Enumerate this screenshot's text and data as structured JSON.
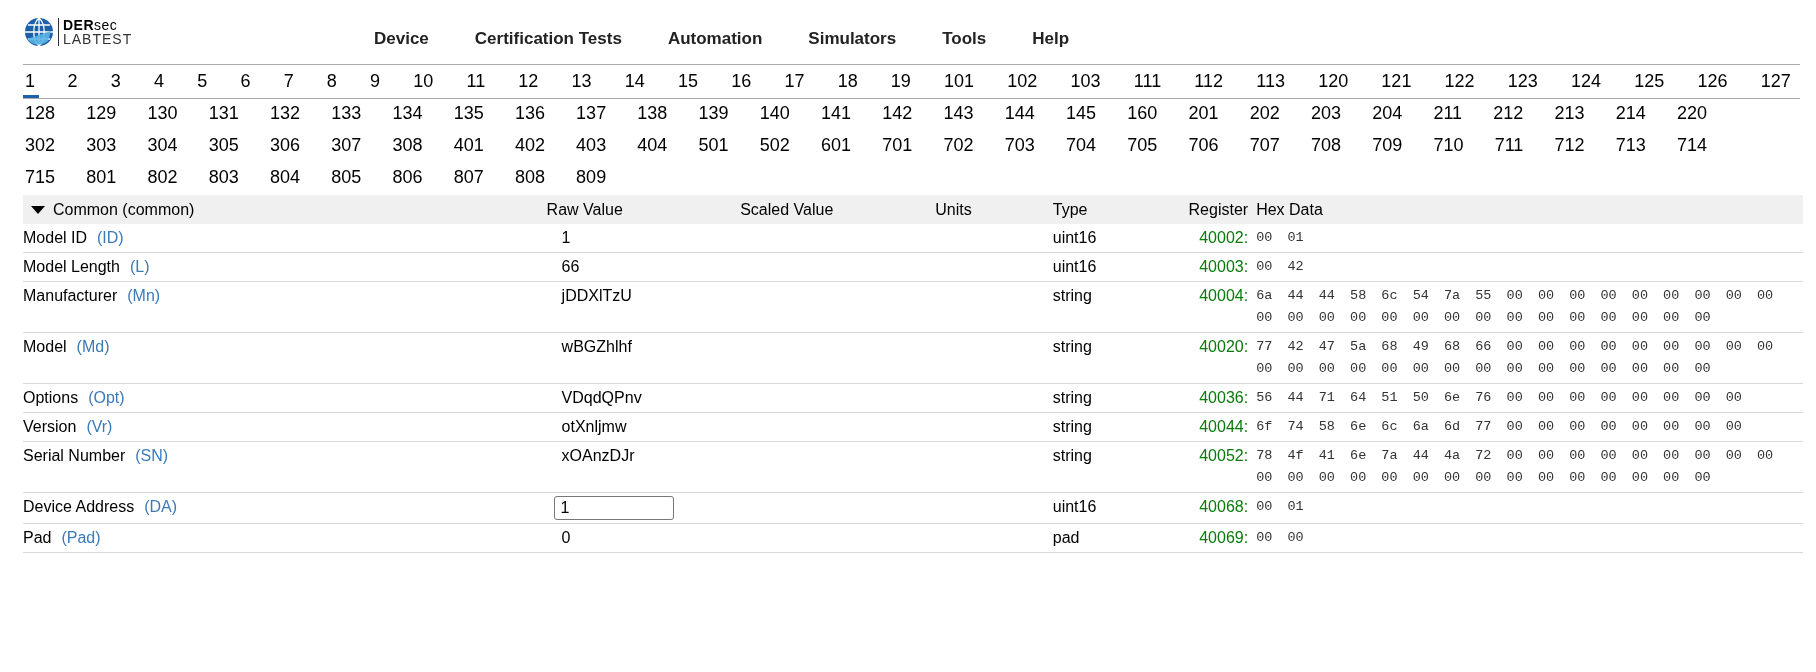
{
  "logo": {
    "brand_bold": "DER",
    "brand_light": "sec",
    "subtitle": "LABTEST"
  },
  "nav": [
    "Device",
    "Certification Tests",
    "Automation",
    "Simulators",
    "Tools",
    "Help"
  ],
  "model_tabs": [
    [
      {
        "label": "1",
        "selected": true
      },
      {
        "label": "2",
        "selected": false
      },
      {
        "label": "3",
        "selected": false
      },
      {
        "label": "4",
        "selected": false
      },
      {
        "label": "5",
        "selected": false
      },
      {
        "label": "6",
        "selected": false
      },
      {
        "label": "7",
        "selected": false
      },
      {
        "label": "8",
        "selected": false
      },
      {
        "label": "9",
        "selected": false
      },
      {
        "label": "10",
        "selected": false
      },
      {
        "label": "11",
        "selected": false
      },
      {
        "label": "12",
        "selected": false
      },
      {
        "label": "13",
        "selected": false
      },
      {
        "label": "14",
        "selected": false
      },
      {
        "label": "15",
        "selected": false
      },
      {
        "label": "16",
        "selected": false
      },
      {
        "label": "17",
        "selected": false
      },
      {
        "label": "18",
        "selected": false
      },
      {
        "label": "19",
        "selected": false
      },
      {
        "label": "101",
        "selected": false
      },
      {
        "label": "102",
        "selected": false
      },
      {
        "label": "103",
        "selected": false
      },
      {
        "label": "111",
        "selected": false
      },
      {
        "label": "112",
        "selected": false
      },
      {
        "label": "113",
        "selected": false
      },
      {
        "label": "120",
        "selected": false
      },
      {
        "label": "121",
        "selected": false
      },
      {
        "label": "122",
        "selected": false
      },
      {
        "label": "123",
        "selected": false
      },
      {
        "label": "124",
        "selected": false
      },
      {
        "label": "125",
        "selected": false
      },
      {
        "label": "126",
        "selected": false
      },
      {
        "label": "127",
        "selected": false
      }
    ],
    [
      {
        "label": "128",
        "selected": false
      },
      {
        "label": "129",
        "selected": false
      },
      {
        "label": "130",
        "selected": false
      },
      {
        "label": "131",
        "selected": false
      },
      {
        "label": "132",
        "selected": false
      },
      {
        "label": "133",
        "selected": false
      },
      {
        "label": "134",
        "selected": false
      },
      {
        "label": "135",
        "selected": false
      },
      {
        "label": "136",
        "selected": false
      },
      {
        "label": "137",
        "selected": false
      },
      {
        "label": "138",
        "selected": false
      },
      {
        "label": "139",
        "selected": false
      },
      {
        "label": "140",
        "selected": false
      },
      {
        "label": "141",
        "selected": false
      },
      {
        "label": "142",
        "selected": false
      },
      {
        "label": "143",
        "selected": false
      },
      {
        "label": "144",
        "selected": false
      },
      {
        "label": "145",
        "selected": false
      },
      {
        "label": "160",
        "selected": false
      },
      {
        "label": "201",
        "selected": false
      },
      {
        "label": "202",
        "selected": false
      },
      {
        "label": "203",
        "selected": false
      },
      {
        "label": "204",
        "selected": false
      },
      {
        "label": "211",
        "selected": false
      },
      {
        "label": "212",
        "selected": false
      },
      {
        "label": "213",
        "selected": false
      },
      {
        "label": "214",
        "selected": false
      },
      {
        "label": "220",
        "selected": false
      }
    ],
    [
      {
        "label": "302",
        "selected": false
      },
      {
        "label": "303",
        "selected": false
      },
      {
        "label": "304",
        "selected": false
      },
      {
        "label": "305",
        "selected": false
      },
      {
        "label": "306",
        "selected": false
      },
      {
        "label": "307",
        "selected": false
      },
      {
        "label": "308",
        "selected": false
      },
      {
        "label": "401",
        "selected": false
      },
      {
        "label": "402",
        "selected": false
      },
      {
        "label": "403",
        "selected": false
      },
      {
        "label": "404",
        "selected": false
      },
      {
        "label": "501",
        "selected": false
      },
      {
        "label": "502",
        "selected": false
      },
      {
        "label": "601",
        "selected": false
      },
      {
        "label": "701",
        "selected": false
      },
      {
        "label": "702",
        "selected": false
      },
      {
        "label": "703",
        "selected": false
      },
      {
        "label": "704",
        "selected": false
      },
      {
        "label": "705",
        "selected": false
      },
      {
        "label": "706",
        "selected": false
      },
      {
        "label": "707",
        "selected": false
      },
      {
        "label": "708",
        "selected": false
      },
      {
        "label": "709",
        "selected": false
      },
      {
        "label": "710",
        "selected": false
      },
      {
        "label": "711",
        "selected": false
      },
      {
        "label": "712",
        "selected": false
      },
      {
        "label": "713",
        "selected": false
      },
      {
        "label": "714",
        "selected": false
      }
    ],
    [
      {
        "label": "715",
        "selected": false
      },
      {
        "label": "801",
        "selected": false
      },
      {
        "label": "802",
        "selected": false
      },
      {
        "label": "803",
        "selected": false
      },
      {
        "label": "804",
        "selected": false
      },
      {
        "label": "805",
        "selected": false
      },
      {
        "label": "806",
        "selected": false
      },
      {
        "label": "807",
        "selected": false
      },
      {
        "label": "808",
        "selected": false
      },
      {
        "label": "809",
        "selected": false
      }
    ]
  ],
  "table": {
    "group": {
      "label": "Common (common)",
      "expanded": true
    },
    "columns": [
      "Raw Value",
      "Scaled Value",
      "Units",
      "Type",
      "Register",
      "Hex Data"
    ],
    "rows": [
      {
        "name": "Model ID",
        "abbr": "(ID)",
        "kind": "text",
        "raw": "1",
        "type": "uint16",
        "register": "40002:",
        "hex": "00 01"
      },
      {
        "name": "Model Length",
        "abbr": "(L)",
        "kind": "text",
        "raw": "66",
        "type": "uint16",
        "register": "40003:",
        "hex": "00 42"
      },
      {
        "name": "Manufacturer",
        "abbr": "(Mn)",
        "kind": "text",
        "raw": "jDDXlTzU",
        "type": "string",
        "register": "40004:",
        "hex": "6a 44 44 58 6c 54 7a 55 00 00 00 00 00 00 00 00 00 00 00 00 00 00 00 00 00 00 00 00 00 00 00 00"
      },
      {
        "name": "Model",
        "abbr": "(Md)",
        "kind": "text",
        "raw": "wBGZhlhf",
        "type": "string",
        "register": "40020:",
        "hex": "77 42 47 5a 68 49 68 66 00 00 00 00 00 00 00 00 00 00 00 00 00 00 00 00 00 00 00 00 00 00 00 00"
      },
      {
        "name": "Options",
        "abbr": "(Opt)",
        "kind": "text",
        "raw": "VDqdQPnv",
        "type": "string",
        "register": "40036:",
        "hex": "56 44 71 64 51 50 6e 76 00 00 00 00 00 00 00 00"
      },
      {
        "name": "Version",
        "abbr": "(Vr)",
        "kind": "text",
        "raw": "otXnljmw",
        "type": "string",
        "register": "40044:",
        "hex": "6f 74 58 6e 6c 6a 6d 77 00 00 00 00 00 00 00 00"
      },
      {
        "name": "Serial Number",
        "abbr": "(SN)",
        "kind": "text",
        "raw": "xOAnzDJr",
        "type": "string",
        "register": "40052:",
        "hex": "78 4f 41 6e 7a 44 4a 72 00 00 00 00 00 00 00 00 00 00 00 00 00 00 00 00 00 00 00 00 00 00 00 00"
      },
      {
        "name": "Device Address",
        "abbr": "(DA)",
        "kind": "input",
        "raw": "1",
        "type": "uint16",
        "register": "40068:",
        "hex": "00 01"
      },
      {
        "name": "Pad",
        "abbr": "(Pad)",
        "kind": "text",
        "raw": "0",
        "type": "pad",
        "register": "40069:",
        "hex": "00 00"
      }
    ]
  }
}
